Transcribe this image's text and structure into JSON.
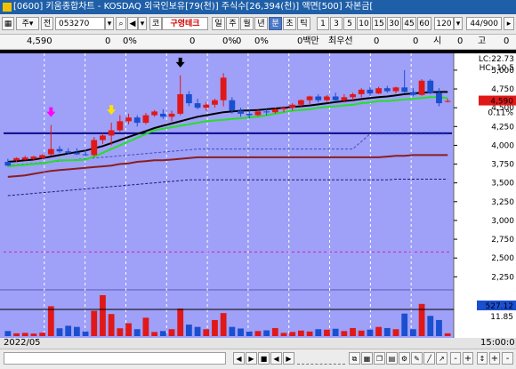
{
  "window": {
    "title": "[0600] 키움종합차트 - KOSDAQ 외국인보유[79(천)] 주식수[26,394(천)] 액면[500] 자본금["
  },
  "toolbar": {
    "type_label": "주",
    "prefix_label": "전",
    "stock_code": "053270",
    "company_name": "구영테크",
    "kr_label": "코",
    "periods": [
      "일",
      "주",
      "월",
      "년",
      "분",
      "초",
      "틱"
    ],
    "selected_period": "분",
    "minute_values": [
      "1",
      "3",
      "5",
      "10",
      "15",
      "30",
      "45",
      "60"
    ],
    "count_value": "120",
    "page_counter": "44/900"
  },
  "info_row": {
    "price": "4,590",
    "change": "0",
    "change_pct": "0%",
    "c1": "0",
    "c1_pct": "0%",
    "c2": "0",
    "c2_pct": "0%",
    "amount_label": "0백만",
    "best_bid_label": "최우선",
    "v1": "0",
    "v2": "0",
    "time_label": "시",
    "time_val": "0",
    "high_label": "고",
    "high_val": "0"
  },
  "chart_data": {
    "type": "candlestick",
    "y_ticks": [
      "5,000",
      "4,750",
      "4,500",
      "4,250",
      "4,000",
      "3,750",
      "3,500",
      "3,250",
      "3,000",
      "2,750",
      "2,500",
      "2,250"
    ],
    "ylim": [
      2100,
      5200
    ],
    "current_price_label": "4,590",
    "current_change_label": "0.11%",
    "lc_label": "LC:22.73",
    "hc_label": "HC:-10.5",
    "volume_high_label": "527.12",
    "volume_low_label": "11.85",
    "date_label": "2022/05",
    "time_label": "15:00:0",
    "candles": [
      {
        "o": 3780,
        "h": 3820,
        "l": 3720,
        "c": 3730
      },
      {
        "o": 3800,
        "h": 3840,
        "l": 3780,
        "c": 3830
      },
      {
        "o": 3810,
        "h": 3860,
        "l": 3800,
        "c": 3840
      },
      {
        "o": 3820,
        "h": 3860,
        "l": 3800,
        "c": 3850
      },
      {
        "o": 3830,
        "h": 3880,
        "l": 3820,
        "c": 3870
      },
      {
        "o": 3880,
        "h": 4270,
        "l": 3860,
        "c": 3950
      },
      {
        "o": 3950,
        "h": 3990,
        "l": 3900,
        "c": 3920
      },
      {
        "o": 3920,
        "h": 3960,
        "l": 3880,
        "c": 3900
      },
      {
        "o": 3900,
        "h": 3960,
        "l": 3870,
        "c": 3880
      },
      {
        "o": 3880,
        "h": 3940,
        "l": 3850,
        "c": 3870
      },
      {
        "o": 3870,
        "h": 4110,
        "l": 3850,
        "c": 4070
      },
      {
        "o": 4070,
        "h": 4160,
        "l": 4020,
        "c": 4130
      },
      {
        "o": 4130,
        "h": 4300,
        "l": 4000,
        "c": 4200
      },
      {
        "o": 4200,
        "h": 4400,
        "l": 4180,
        "c": 4320
      },
      {
        "o": 4320,
        "h": 4420,
        "l": 4280,
        "c": 4370
      },
      {
        "o": 4370,
        "h": 4400,
        "l": 4250,
        "c": 4300
      },
      {
        "o": 4300,
        "h": 4430,
        "l": 4280,
        "c": 4400
      },
      {
        "o": 4400,
        "h": 4470,
        "l": 4380,
        "c": 4450
      },
      {
        "o": 4420,
        "h": 4480,
        "l": 4350,
        "c": 4380
      },
      {
        "o": 4380,
        "h": 4460,
        "l": 4320,
        "c": 4420
      },
      {
        "o": 4420,
        "h": 4930,
        "l": 4400,
        "c": 4680
      },
      {
        "o": 4680,
        "h": 4720,
        "l": 4520,
        "c": 4560
      },
      {
        "o": 4560,
        "h": 4620,
        "l": 4480,
        "c": 4500
      },
      {
        "o": 4500,
        "h": 4580,
        "l": 4460,
        "c": 4540
      },
      {
        "o": 4540,
        "h": 4620,
        "l": 4500,
        "c": 4600
      },
      {
        "o": 4600,
        "h": 4960,
        "l": 4520,
        "c": 4900
      },
      {
        "o": 4600,
        "h": 4640,
        "l": 4420,
        "c": 4460
      },
      {
        "o": 4460,
        "h": 4500,
        "l": 4380,
        "c": 4420
      },
      {
        "o": 4420,
        "h": 4470,
        "l": 4360,
        "c": 4400
      },
      {
        "o": 4400,
        "h": 4470,
        "l": 4390,
        "c": 4450
      },
      {
        "o": 4450,
        "h": 4480,
        "l": 4400,
        "c": 4440
      },
      {
        "o": 4440,
        "h": 4500,
        "l": 4420,
        "c": 4480
      },
      {
        "o": 4480,
        "h": 4520,
        "l": 4440,
        "c": 4500
      },
      {
        "o": 4500,
        "h": 4560,
        "l": 4460,
        "c": 4540
      },
      {
        "o": 4540,
        "h": 4610,
        "l": 4520,
        "c": 4600
      },
      {
        "o": 4600,
        "h": 4660,
        "l": 4550,
        "c": 4650
      },
      {
        "o": 4650,
        "h": 4680,
        "l": 4570,
        "c": 4600
      },
      {
        "o": 4600,
        "h": 4670,
        "l": 4580,
        "c": 4650
      },
      {
        "o": 4650,
        "h": 4700,
        "l": 4580,
        "c": 4600
      },
      {
        "o": 4600,
        "h": 4680,
        "l": 4570,
        "c": 4640
      },
      {
        "o": 4640,
        "h": 4700,
        "l": 4600,
        "c": 4680
      },
      {
        "o": 4680,
        "h": 4760,
        "l": 4640,
        "c": 4740
      },
      {
        "o": 4740,
        "h": 4780,
        "l": 4660,
        "c": 4690
      },
      {
        "o": 4690,
        "h": 4780,
        "l": 4680,
        "c": 4760
      },
      {
        "o": 4760,
        "h": 4790,
        "l": 4700,
        "c": 4720
      },
      {
        "o": 4720,
        "h": 4780,
        "l": 4690,
        "c": 4770
      },
      {
        "o": 4770,
        "h": 5000,
        "l": 4700,
        "c": 4710
      },
      {
        "o": 4710,
        "h": 4760,
        "l": 4650,
        "c": 4670
      },
      {
        "o": 4670,
        "h": 4880,
        "l": 4660,
        "c": 4860
      },
      {
        "o": 4860,
        "h": 4880,
        "l": 4680,
        "c": 4700
      },
      {
        "o": 4700,
        "h": 4760,
        "l": 4520,
        "c": 4560
      },
      {
        "o": 4580,
        "h": 4620,
        "l": 4570,
        "c": 4590
      }
    ],
    "volumes": [
      22,
      12,
      14,
      11,
      15,
      130,
      34,
      45,
      40,
      20,
      110,
      178,
      96,
      34,
      56,
      30,
      80,
      18,
      22,
      30,
      120,
      50,
      40,
      30,
      70,
      100,
      40,
      33,
      20,
      22,
      25,
      35,
      14,
      18,
      24,
      20,
      30,
      28,
      32,
      22,
      35,
      24,
      28,
      40,
      35,
      30,
      98,
      30,
      140,
      88,
      70,
      12
    ],
    "ma_black": [
      3780,
      3790,
      3800,
      3810,
      3830,
      3850,
      3870,
      3890,
      3910,
      3930,
      3960,
      3990,
      4030,
      4070,
      4110,
      4150,
      4190,
      4230,
      4260,
      4290,
      4320,
      4350,
      4380,
      4400,
      4420,
      4440,
      4450,
      4460,
      4465,
      4470,
      4480,
      4490,
      4500,
      4510,
      4520,
      4530,
      4545,
      4560,
      4575,
      4590,
      4600,
      4615,
      4630,
      4640,
      4650,
      4665,
      4680,
      4690,
      4700,
      4705,
      4710,
      4710
    ],
    "ma_green": [
      3720,
      3730,
      3740,
      3750,
      3760,
      3780,
      3800,
      3800,
      3800,
      3810,
      3850,
      3900,
      3950,
      4000,
      4050,
      4100,
      4150,
      4200,
      4220,
      4240,
      4260,
      4280,
      4300,
      4320,
      4330,
      4340,
      4350,
      4360,
      4370,
      4380,
      4400,
      4420,
      4440,
      4460,
      4470,
      4480,
      4500,
      4510,
      4520,
      4530,
      4540,
      4560,
      4570,
      4590,
      4590,
      4600,
      4610,
      4620,
      4630,
      4640,
      4640,
      4630
    ],
    "ma_darkred": [
      3580,
      3590,
      3600,
      3620,
      3640,
      3660,
      3670,
      3680,
      3690,
      3700,
      3710,
      3720,
      3730,
      3750,
      3760,
      3780,
      3790,
      3800,
      3800,
      3810,
      3820,
      3830,
      3840,
      3840,
      3840,
      3840,
      3840,
      3840,
      3840,
      3840,
      3840,
      3840,
      3840,
      3840,
      3840,
      3840,
      3840,
      3840,
      3840,
      3840,
      3840,
      3840,
      3840,
      3840,
      3850,
      3860,
      3860,
      3870,
      3870,
      3870,
      3870,
      3870
    ],
    "ma_darkblue_dash": [
      3330,
      3340,
      3350,
      3360,
      3370,
      3380,
      3390,
      3400,
      3410,
      3420,
      3430,
      3440,
      3450,
      3460,
      3470,
      3480,
      3490,
      3500,
      3510,
      3520,
      3530,
      3540,
      3540,
      3540,
      3540,
      3540,
      3540,
      3540,
      3540,
      3540,
      3540,
      3540,
      3540,
      3540,
      3540,
      3540,
      3540,
      3540,
      3540,
      3540,
      3540,
      3540,
      3540,
      3540,
      3540,
      3550,
      3550,
      3550,
      3550,
      3550,
      3550,
      3550
    ],
    "ma_lightblue_dash": [
      3730,
      3740,
      3750,
      3760,
      3770,
      3780,
      3790,
      3800,
      3810,
      3820,
      3830,
      3840,
      3850,
      3860,
      3870,
      3880,
      3890,
      3900,
      3910,
      3920,
      3930,
      3940,
      3950,
      3950,
      3950,
      3950,
      3950,
      3950,
      3950,
      3950,
      3950,
      3950,
      3950,
      3950,
      3950,
      3950,
      3950,
      3950,
      3950,
      3950,
      3950,
      4050,
      4150,
      4150,
      4150,
      4150,
      4150,
      4150,
      4150,
      4150,
      4150,
      4150
    ],
    "hline_navy": 4160,
    "hline_darkred": 3870,
    "hline_magenta": 2580,
    "markers": [
      {
        "candle": 5,
        "color": "#ff00ff"
      },
      {
        "candle": 12,
        "color": "#ffe000"
      },
      {
        "candle": 20,
        "color": "#000000"
      }
    ],
    "vertical_gridlines": 10
  },
  "scrollbar": {
    "buttons": [
      "◀",
      "▶",
      "■",
      "◀",
      "▶",
      "+",
      "-",
      "+",
      "-"
    ]
  }
}
